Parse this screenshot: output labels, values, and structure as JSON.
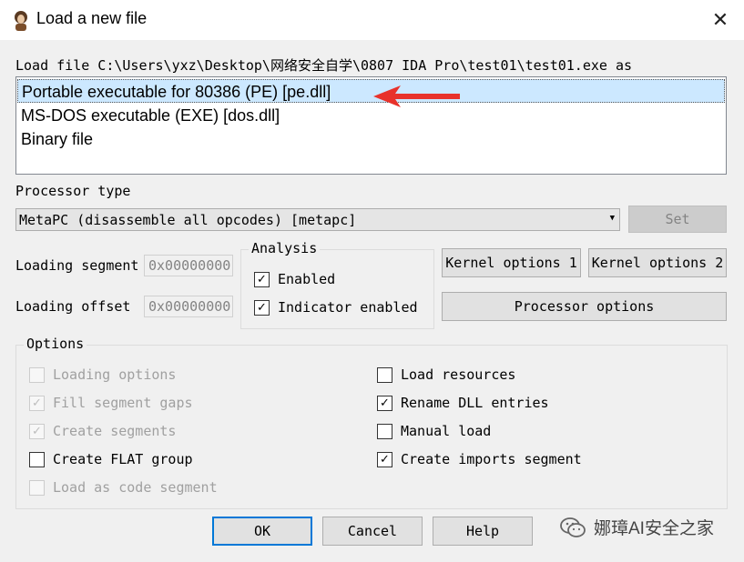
{
  "window": {
    "title": "Load a new file",
    "close_glyph": "✕",
    "icon": "ida-icon"
  },
  "load_file_label": "Load file C:\\Users\\yxz\\Desktop\\网络安全自学\\0807 IDA Pro\\test01\\test01.exe as",
  "loader_list": [
    {
      "label": "Portable executable for 80386 (PE) [pe.dll]",
      "selected": true
    },
    {
      "label": "MS-DOS executable (EXE) [dos.dll]",
      "selected": false
    },
    {
      "label": "Binary file",
      "selected": false
    }
  ],
  "processor": {
    "label": "Processor type",
    "value": "MetaPC (disassemble all opcodes) [metapc]",
    "set_label": "Set"
  },
  "loading_segment": {
    "label": "Loading segment",
    "value": "0x00000000"
  },
  "loading_offset": {
    "label": "Loading offset",
    "value": "0x00000000"
  },
  "analysis": {
    "title": "Analysis",
    "enabled": {
      "label": "Enabled",
      "checked": true
    },
    "indicator": {
      "label": "Indicator enabled",
      "checked": true
    }
  },
  "buttons": {
    "kernel1": "Kernel options 1",
    "kernel2": "Kernel options 2",
    "processor_options": "Processor options",
    "ok": "OK",
    "cancel": "Cancel",
    "help": "Help"
  },
  "options": {
    "title": "Options",
    "left": [
      {
        "label": "Loading options",
        "checked": false,
        "disabled": true
      },
      {
        "label": "Fill segment gaps",
        "checked": true,
        "disabled": true
      },
      {
        "label": "Create segments",
        "checked": true,
        "disabled": true
      },
      {
        "label": "Create FLAT group",
        "checked": false,
        "disabled": false
      },
      {
        "label": "Load as code segment",
        "checked": false,
        "disabled": true
      }
    ],
    "right": [
      {
        "label": "Load resources",
        "checked": false,
        "disabled": false
      },
      {
        "label": "Rename DLL entries",
        "checked": true,
        "disabled": false
      },
      {
        "label": "Manual load",
        "checked": false,
        "disabled": false
      },
      {
        "label": "Create imports segment",
        "checked": true,
        "disabled": false
      }
    ]
  },
  "check_glyph": "✓",
  "watermark": "娜璋AI安全之家",
  "colors": {
    "selection": "#cce8ff",
    "arrow": "#e8322b",
    "default_border": "#0078d7"
  }
}
